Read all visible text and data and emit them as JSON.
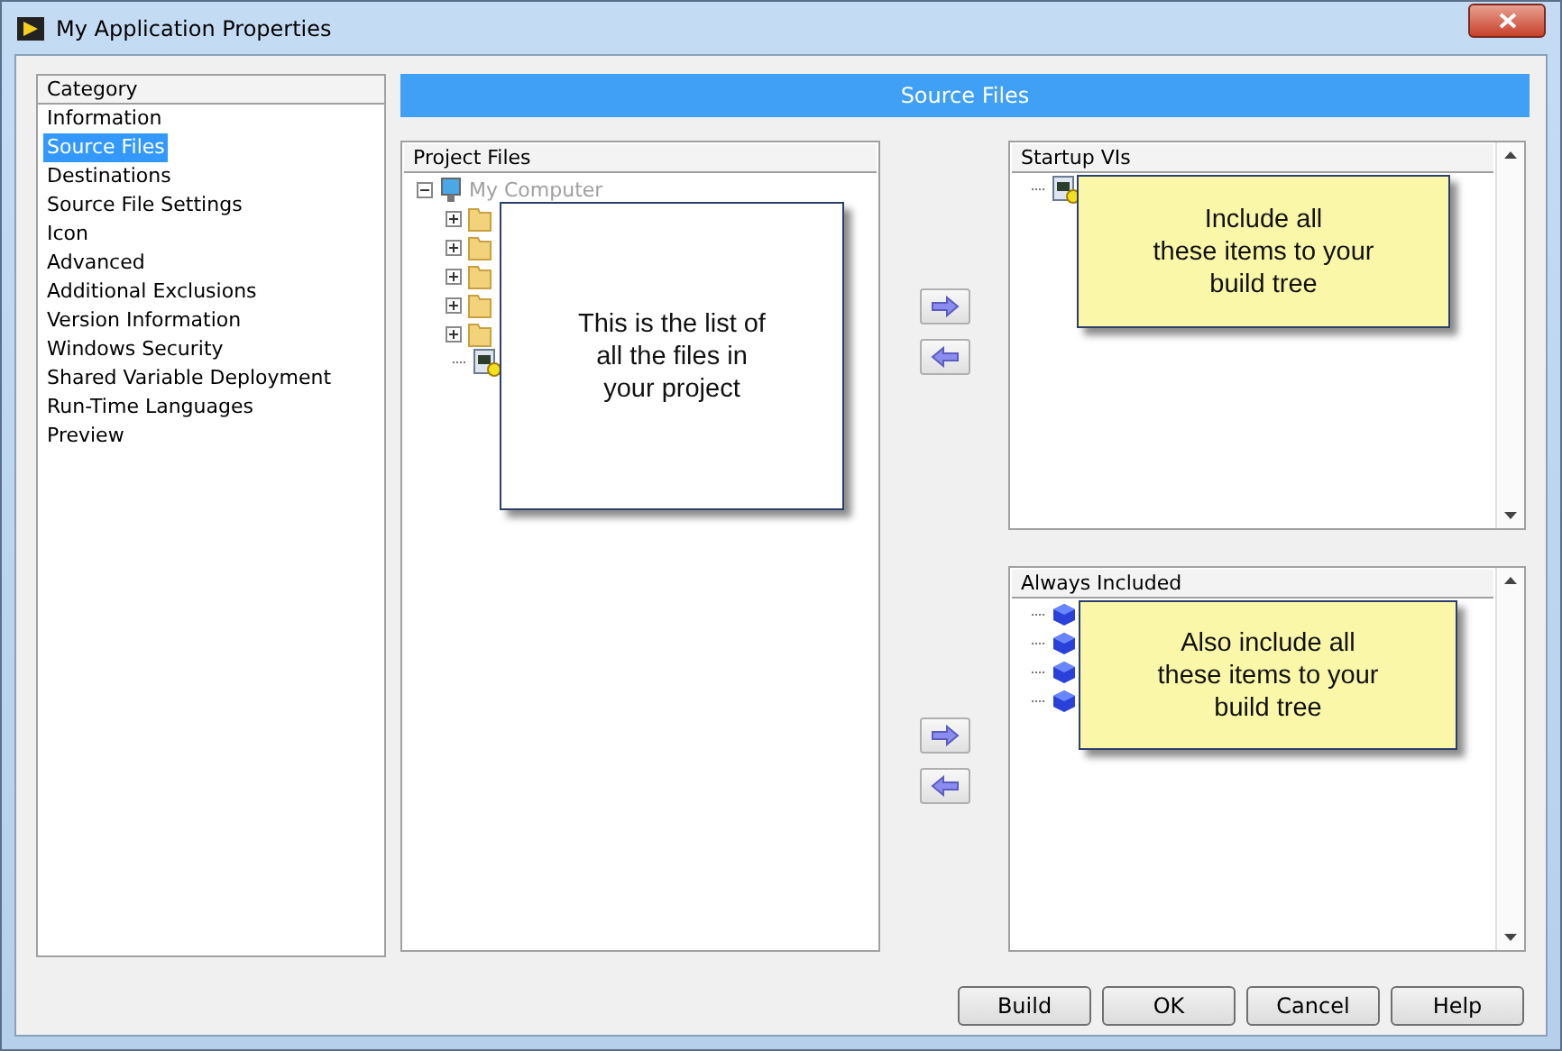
{
  "window": {
    "title": "My Application Properties"
  },
  "category": {
    "title": "Category",
    "items": [
      {
        "label": "Information",
        "selected": false
      },
      {
        "label": "Source Files",
        "selected": true
      },
      {
        "label": "Destinations",
        "selected": false
      },
      {
        "label": "Source File Settings",
        "selected": false
      },
      {
        "label": "Icon",
        "selected": false
      },
      {
        "label": "Advanced",
        "selected": false
      },
      {
        "label": "Additional Exclusions",
        "selected": false
      },
      {
        "label": "Version Information",
        "selected": false
      },
      {
        "label": "Windows Security",
        "selected": false
      },
      {
        "label": "Shared Variable Deployment",
        "selected": false
      },
      {
        "label": "Run-Time Languages",
        "selected": false
      },
      {
        "label": "Preview",
        "selected": false
      }
    ]
  },
  "header": "Source Files",
  "project_files": {
    "title": "Project Files",
    "root": {
      "label": "My Computer",
      "disabled": true,
      "expanded": true,
      "children": [
        {
          "kind": "folder"
        },
        {
          "kind": "folder"
        },
        {
          "kind": "folder"
        },
        {
          "kind": "folder"
        },
        {
          "kind": "folder"
        },
        {
          "kind": "vi"
        }
      ]
    },
    "callout": "This is the list of\nall the files in\nyour project"
  },
  "startup_vis": {
    "title": "Startup VIs",
    "items": [
      {
        "kind": "vi"
      }
    ],
    "callout": "Include all\nthese items to your\nbuild tree"
  },
  "always_included": {
    "title": "Always Included",
    "items": [
      {
        "kind": "cube"
      },
      {
        "kind": "cube"
      },
      {
        "kind": "cube"
      },
      {
        "kind": "cube"
      }
    ],
    "callout": "Also include all\nthese items to your\nbuild tree"
  },
  "buttons": [
    "Build",
    "OK",
    "Cancel",
    "Help"
  ]
}
